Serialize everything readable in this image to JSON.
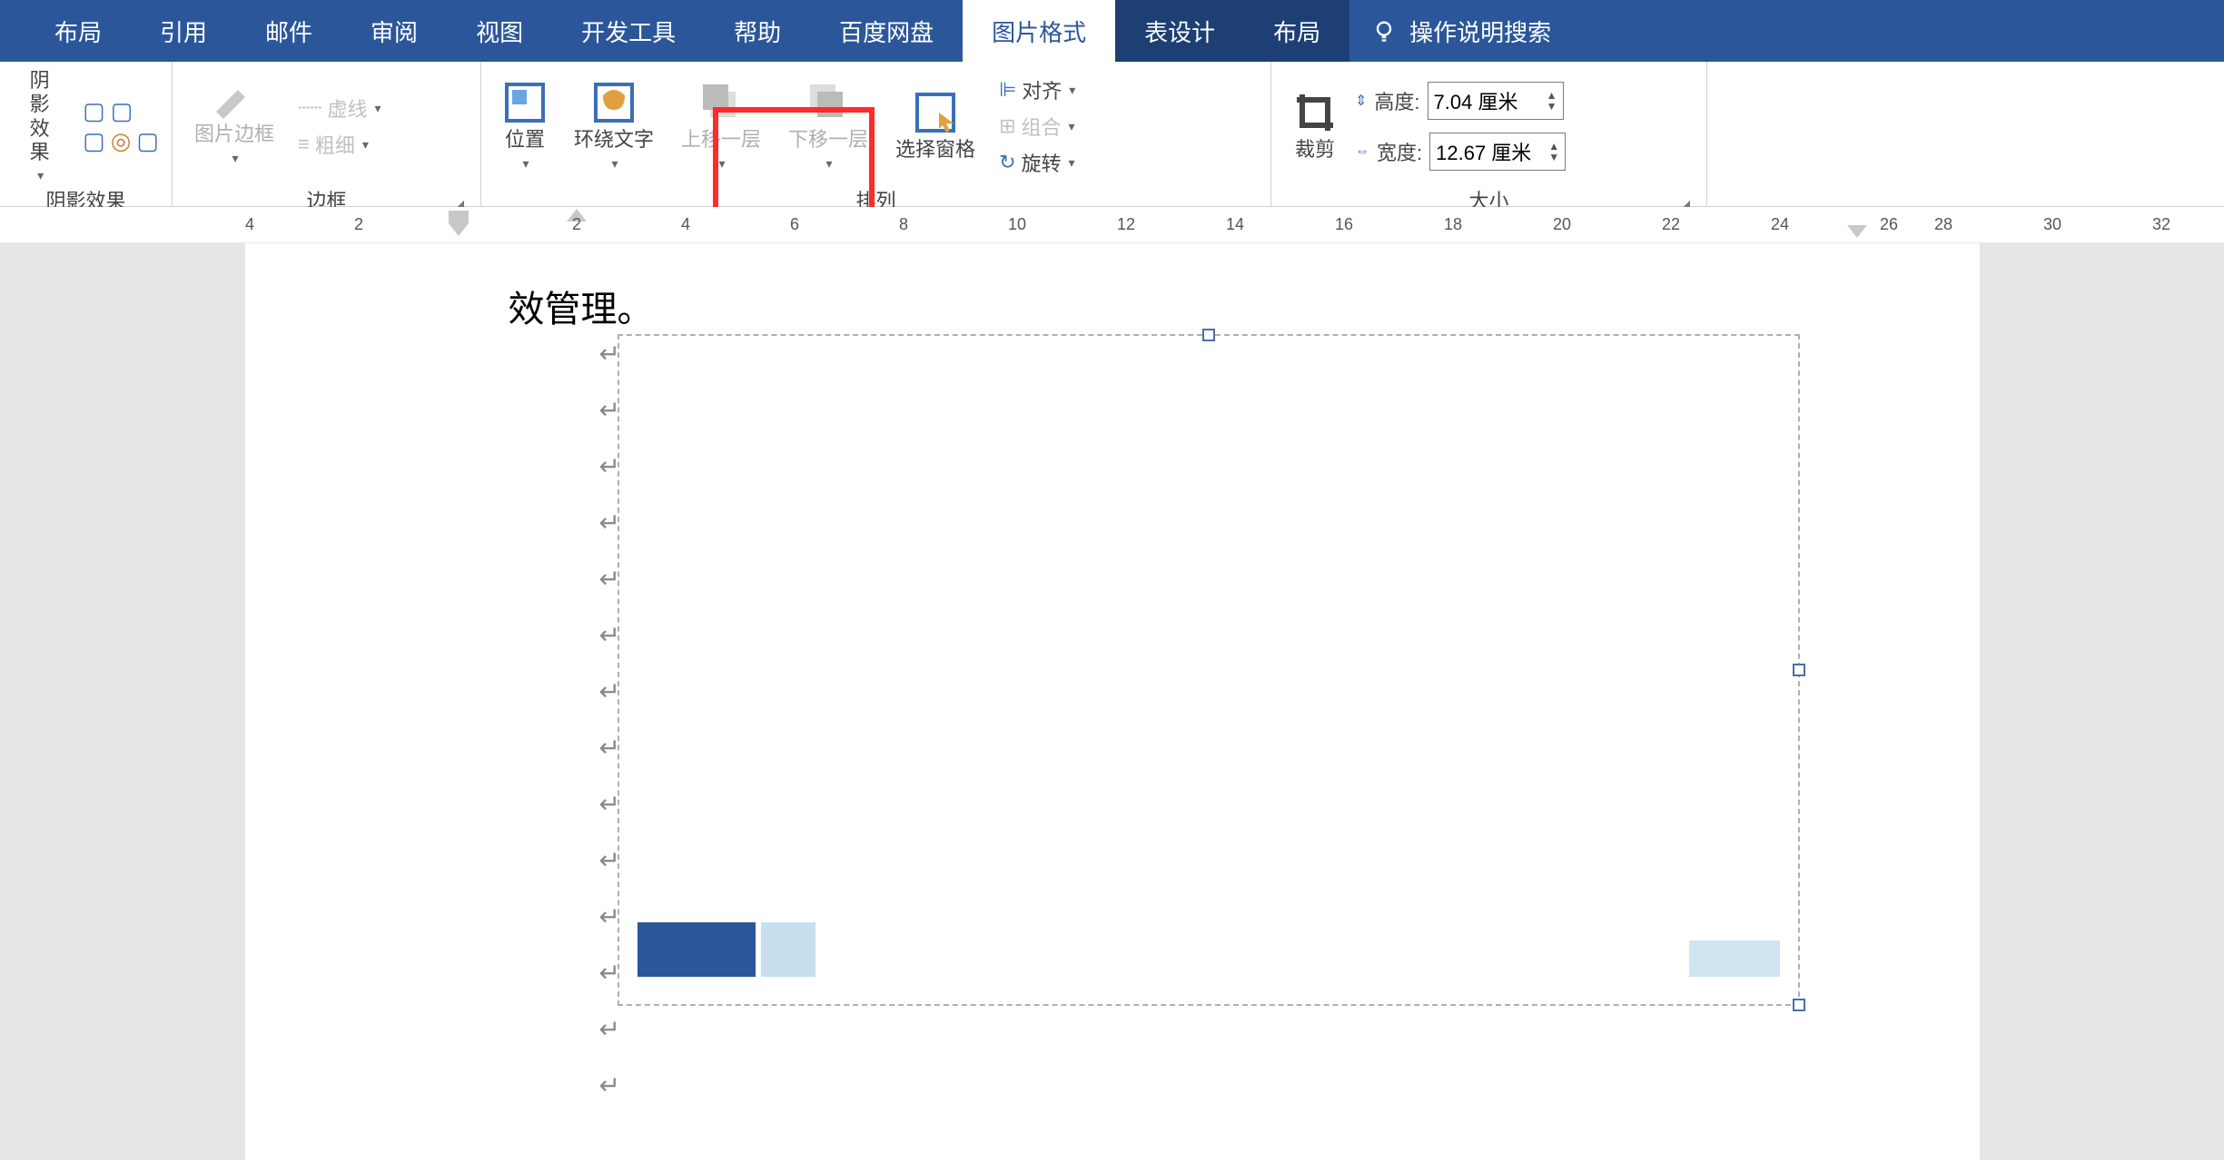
{
  "tabs": {
    "layout": "布局",
    "references": "引用",
    "mailings": "邮件",
    "review": "审阅",
    "view": "视图",
    "dev": "开发工具",
    "help": "帮助",
    "baidu": "百度网盘",
    "picfmt": "图片格式",
    "tbldesign": "表设计",
    "layout2": "布局",
    "tellme": "操作说明搜索"
  },
  "groups": {
    "shadow": {
      "label": "阴影效果",
      "btn": "阴影效果"
    },
    "border": {
      "label": "边框",
      "edit": "图片边框",
      "dash": "虚线",
      "weight": "粗细"
    },
    "arrange": {
      "label": "排列",
      "position": "位置",
      "wrap": "环绕文字",
      "forward": "上移一层",
      "backward": "下移一层",
      "pane": "选择窗格",
      "align": "对齐",
      "group": "组合",
      "rotate": "旋转"
    },
    "size": {
      "label": "大小",
      "crop": "裁剪",
      "height_lbl": "高度:",
      "height_val": "7.04 厘米",
      "width_lbl": "宽度:",
      "width_val": "12.67 厘米"
    }
  },
  "ruler": [
    "4",
    "2",
    "",
    "2",
    "4",
    "6",
    "8",
    "10",
    "12",
    "14",
    "16",
    "18",
    "20",
    "22",
    "24",
    "26",
    "28",
    "30",
    "32"
  ],
  "doc": {
    "text": "效管理。"
  }
}
